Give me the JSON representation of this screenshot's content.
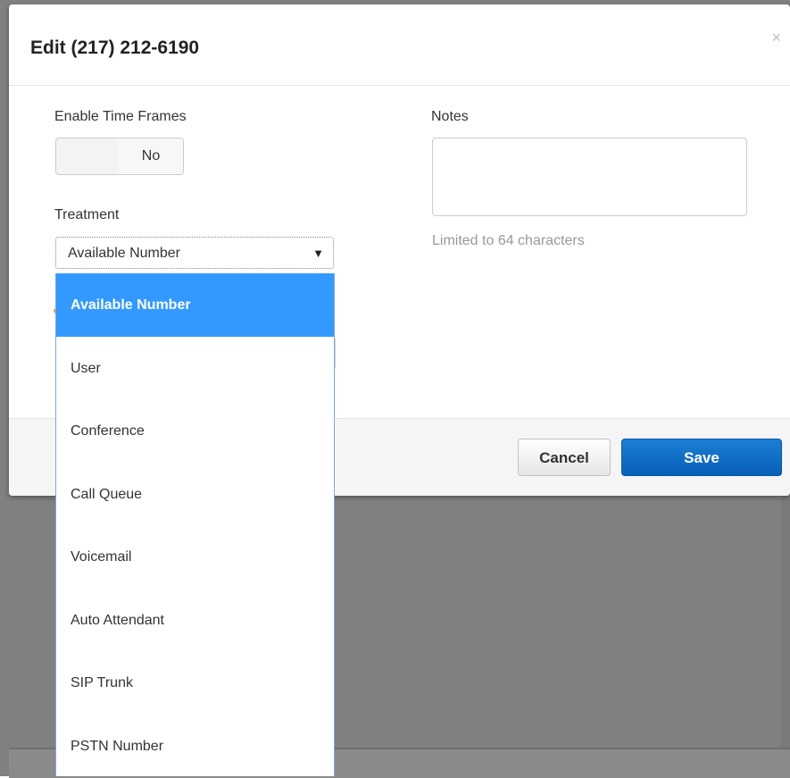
{
  "dialog": {
    "title": "Edit (217) 212-6190",
    "close_glyph": "×"
  },
  "form": {
    "enable_time_frames": {
      "label": "Enable Time Frames",
      "value": "No"
    },
    "treatment": {
      "label": "Treatment",
      "selected": "Available Number",
      "caret_glyph": "▼",
      "options": [
        "Available Number",
        "User",
        "Conference",
        "Call Queue",
        "Voicemail",
        "Auto Attendant",
        "SIP Trunk",
        "PSTN Number"
      ]
    },
    "notes": {
      "label": "Notes",
      "value": "",
      "help": "Limited to 64 characters"
    }
  },
  "footer": {
    "cancel_label": "Cancel",
    "save_label": "Save"
  },
  "colors": {
    "selected_option": "#3399ff",
    "save_button": "#0a64c4",
    "backdrop": "#808080"
  },
  "icons": {
    "close": "close-icon",
    "select_caret": "chevron-down-icon"
  }
}
